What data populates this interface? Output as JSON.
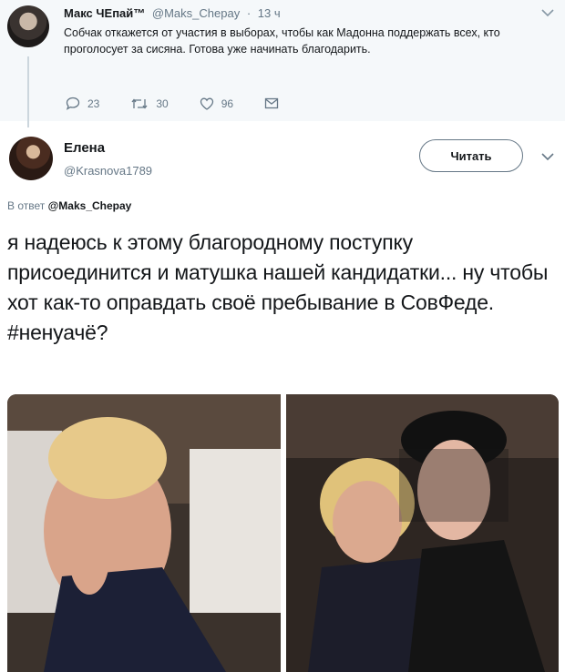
{
  "parent_tweet": {
    "name": "Макс ЧЕпай™",
    "handle": "@Maks_Chepay",
    "time": "13 ч",
    "text": "Собчак откажется от участия в выборах, чтобы как Мадонна поддержать всех, кто проголосует за сисяна. Готова уже начинать благодарить.",
    "replies": "23",
    "retweets": "30",
    "likes": "96"
  },
  "main_tweet": {
    "name": "Елена",
    "handle": "@Krasnova1789",
    "follow_label": "Читать",
    "reply_prefix": "В ответ",
    "reply_handle": "@Maks_Chepay",
    "text": "я надеюсь к этому благородному поступку присоединится и матушка нашей кандидатки... ну чтобы хот как-то оправдать своё пребывание в СовФеде. #ненуачё?"
  },
  "icons": {
    "chevron": "chevron-down-icon",
    "reply": "reply-icon",
    "retweet": "retweet-icon",
    "like": "heart-icon",
    "message": "envelope-icon"
  },
  "colors": {
    "muted": "#657786",
    "parent_bg": "#f5f8fa"
  }
}
